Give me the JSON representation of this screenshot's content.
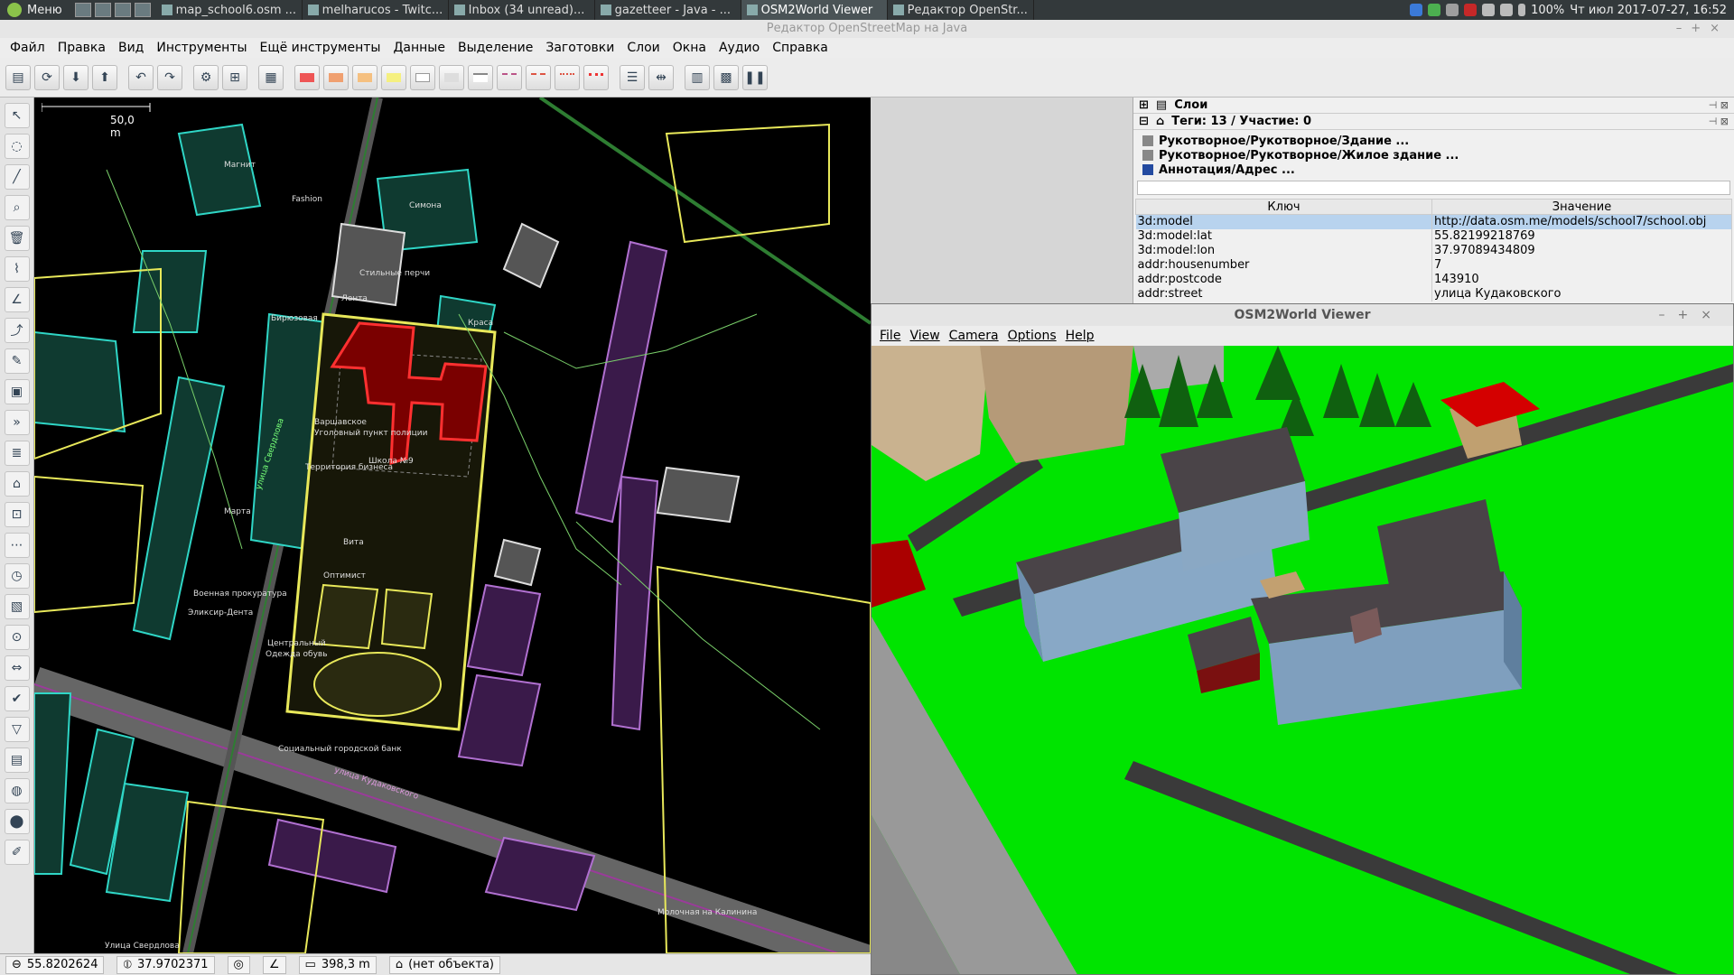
{
  "taskbar": {
    "menu_label": "Меню",
    "tasks": [
      {
        "label": "map_school6.osm ..."
      },
      {
        "label": "melharucos - Twitc..."
      },
      {
        "label": "Inbox (34 unread)..."
      },
      {
        "label": "gazetteer - Java - ..."
      },
      {
        "label": "OSM2World Viewer"
      },
      {
        "label": "Редактор OpenStr..."
      }
    ],
    "battery": "100%",
    "clock": "Чт июл 2017-07-27, 16:52"
  },
  "window_title": "Редактор OpenStreetMap на Java",
  "menubar": [
    "Файл",
    "Правка",
    "Вид",
    "Инструменты",
    "Ещё инструменты",
    "Данные",
    "Выделение",
    "Заготовки",
    "Слои",
    "Окна",
    "Аудио",
    "Справка"
  ],
  "map": {
    "scale_label": "50,0 m",
    "labels": [
      {
        "text": "Школа №9",
        "pos": "school"
      },
      {
        "text": "улица Свердлова",
        "pos": "street1"
      },
      {
        "text": "улица Кудаковского",
        "pos": "street2"
      },
      {
        "text": "Марта",
        "pos": "p1"
      },
      {
        "text": "Лента",
        "pos": "p2"
      },
      {
        "text": "Стильные перчи",
        "pos": "p3"
      },
      {
        "text": "Варшавское",
        "pos": "p4"
      },
      {
        "text": "Уголовный пункт полиции",
        "pos": "p5"
      },
      {
        "text": "Территория бизнеса",
        "pos": "p6"
      },
      {
        "text": "Военная прокуратура",
        "pos": "p7"
      },
      {
        "text": "Эликсир-Дента",
        "pos": "p8"
      },
      {
        "text": "Центральный",
        "pos": "p9"
      },
      {
        "text": "Одежда обувь",
        "pos": "p10"
      },
      {
        "text": "Социальный городской банк",
        "pos": "p11"
      },
      {
        "text": "Улица Свердлова",
        "pos": "p12"
      },
      {
        "text": "Магнит",
        "pos": "p13"
      },
      {
        "text": "Fashion",
        "pos": "p14"
      },
      {
        "text": "Симона",
        "pos": "p15"
      },
      {
        "text": "Бирюзовая",
        "pos": "p16"
      },
      {
        "text": "Вита",
        "pos": "p17"
      },
      {
        "text": "Оптимист",
        "pos": "p18"
      },
      {
        "text": "Молочная на Калинина",
        "pos": "p19"
      },
      {
        "text": "Краса",
        "pos": "p20"
      }
    ]
  },
  "statusbar": {
    "lat": "55.8202624",
    "lon": "37.9702371",
    "distance": "398,3 m",
    "object": "(нет объекта)"
  },
  "sidepanel": {
    "layers_title": "Слои",
    "tags_title": "Теги: 13 / Участие: 0",
    "presets": [
      "Рукотворное/Рукотворное/Здание ...",
      "Рукотворное/Рукотворное/Жилое здание ...",
      "Аннотация/Адрес ..."
    ],
    "columns": [
      "Ключ",
      "Значение"
    ],
    "rows": [
      {
        "key": "3d:model",
        "value": "http://data.osm.me/models/school7/school.obj"
      },
      {
        "key": "3d:model:lat",
        "value": "55.82199218769"
      },
      {
        "key": "3d:model:lon",
        "value": "37.97089434809"
      },
      {
        "key": "addr:housenumber",
        "value": "7"
      },
      {
        "key": "addr:postcode",
        "value": "143910"
      },
      {
        "key": "addr:street",
        "value": "улица Кудаковского"
      }
    ]
  },
  "viewer": {
    "title": "OSM2World Viewer",
    "menu": [
      "File",
      "View",
      "Camera",
      "Options",
      "Help"
    ]
  }
}
